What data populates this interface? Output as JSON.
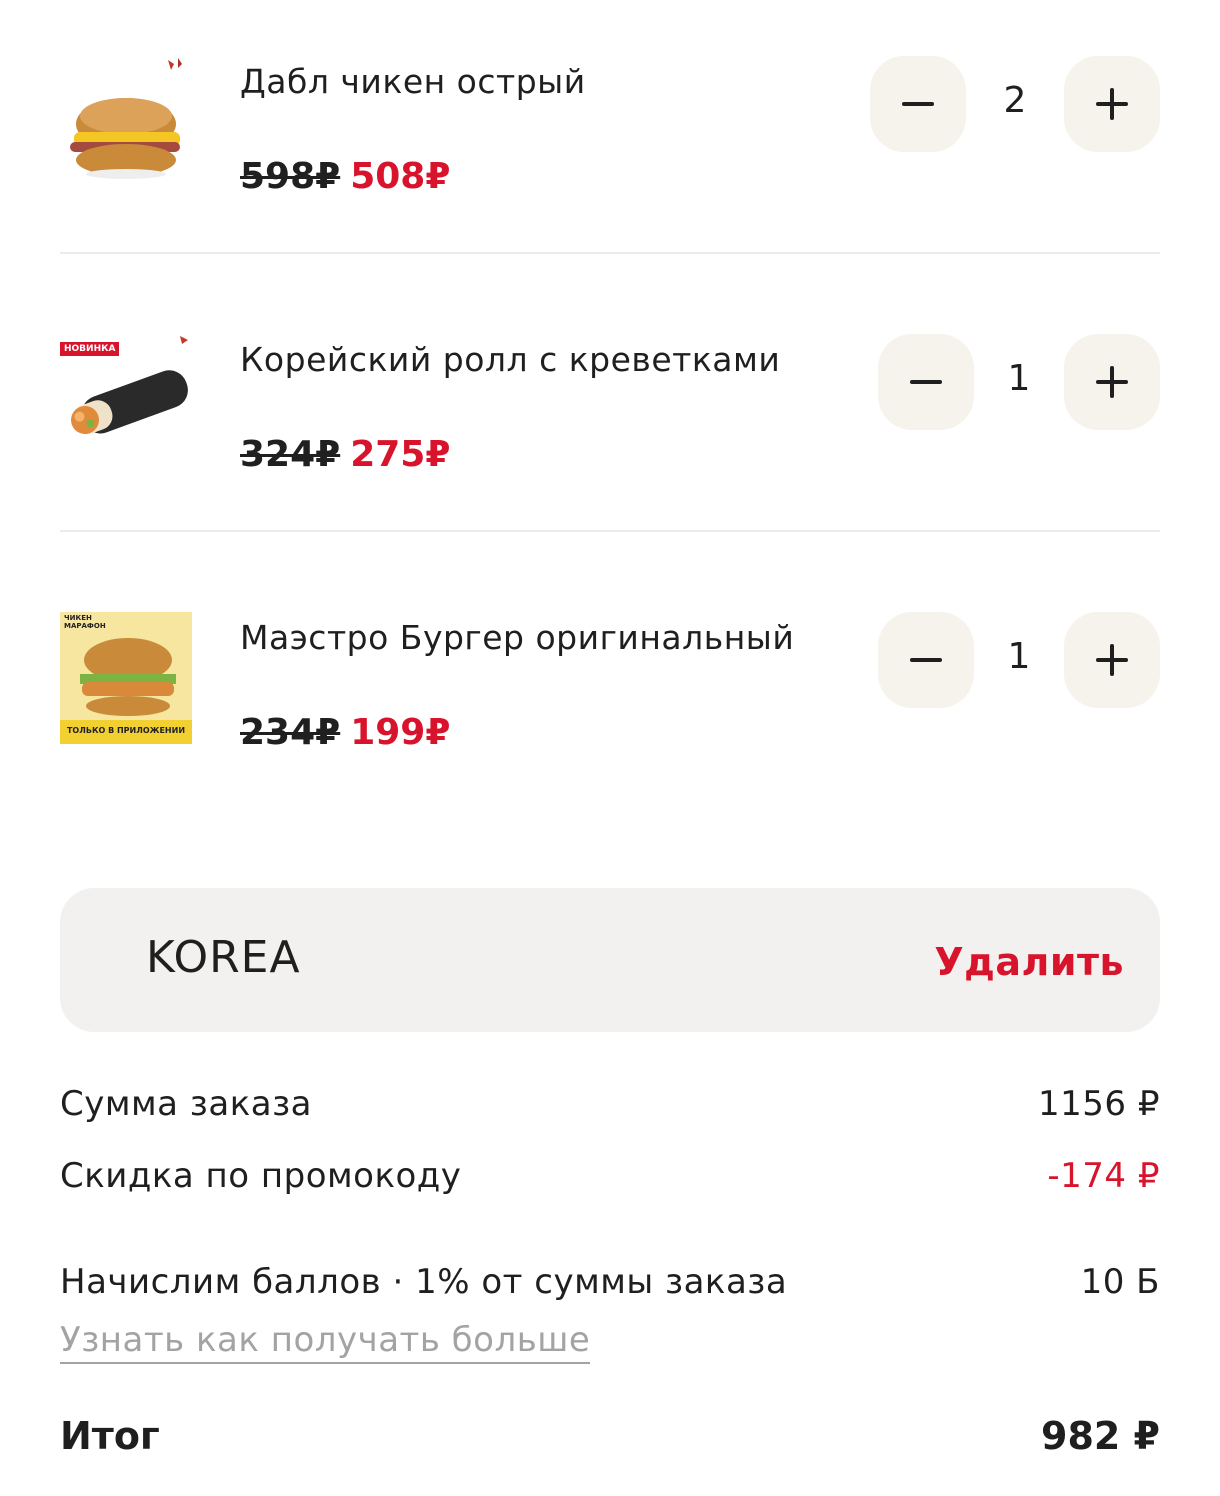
{
  "items": [
    {
      "name": "Дабл чикен острый",
      "old_price": "598₽",
      "new_price": "508₽",
      "qty": "2"
    },
    {
      "name": "Корейский ролл с креветками",
      "old_price": "324₽",
      "new_price": "275₽",
      "qty": "1",
      "badge": "НОВИНКА"
    },
    {
      "name": "Маэстро Бургер оригинальный",
      "old_price": "234₽",
      "new_price": "199₽",
      "qty": "1",
      "badge_top": "ЧИКЕН МАРАФОН",
      "badge_bottom": "ТОЛЬКО В ПРИЛОЖЕНИИ"
    }
  ],
  "promo": {
    "code": "KOREA",
    "remove_label": "Удалить"
  },
  "summary": {
    "order_sum_label": "Сумма заказа",
    "order_sum_value": "1156 ₽",
    "discount_label": "Скидка по промокоду",
    "discount_value": "-174 ₽",
    "points_label": "Начислим баллов · 1% от суммы заказа",
    "points_value": "10 Б",
    "learn_more": "Узнать как получать больше",
    "total_label": "Итог",
    "total_value": "982 ₽"
  },
  "colors": {
    "accent": "#d8142c",
    "button_bg": "#f6f3ec",
    "promo_bg": "#f2f1f0"
  }
}
